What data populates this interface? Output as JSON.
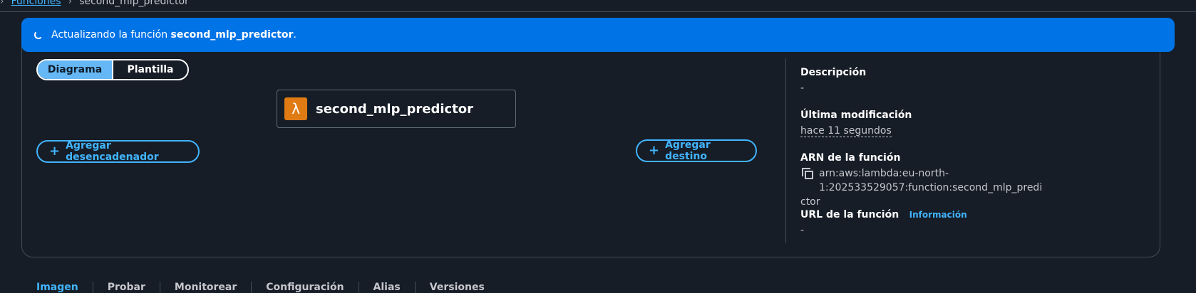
{
  "breadcrumb": {
    "parent": "Funciones",
    "current": "second_mlp_predictor"
  },
  "flash": {
    "prefix": "Actualizando la función ",
    "function_name": "second_mlp_predictor",
    "suffix": "."
  },
  "view_toggle": {
    "diagram": "Diagrama",
    "template": "Plantilla",
    "selected": "Diagrama"
  },
  "function_node": {
    "name": "second_mlp_predictor",
    "icon": "lambda-icon",
    "icon_glyph": "λ",
    "icon_color": "#e07b14"
  },
  "buttons": {
    "add_trigger": "Agregar desencadenador",
    "add_destination": "Agregar destino"
  },
  "details": {
    "description_label": "Descripción",
    "description_value": "-",
    "last_modified_label": "Última modificación",
    "last_modified_value": "hace 11 segundos",
    "arn_label": "ARN de la función",
    "arn_value_line1": "arn:aws:lambda:eu-north-1:202533529057:function:second_mlp_predi",
    "arn_value_line2": "ctor",
    "url_label": "URL de la función",
    "url_info_link": "Información",
    "url_value": "-"
  },
  "tabs": [
    "Imagen",
    "Probar",
    "Monitorear",
    "Configuración",
    "Alias",
    "Versiones"
  ],
  "active_tab": "Imagen",
  "colors": {
    "accent": "#42b4ff",
    "flash_bg": "#0073e6",
    "background": "#161d26"
  }
}
